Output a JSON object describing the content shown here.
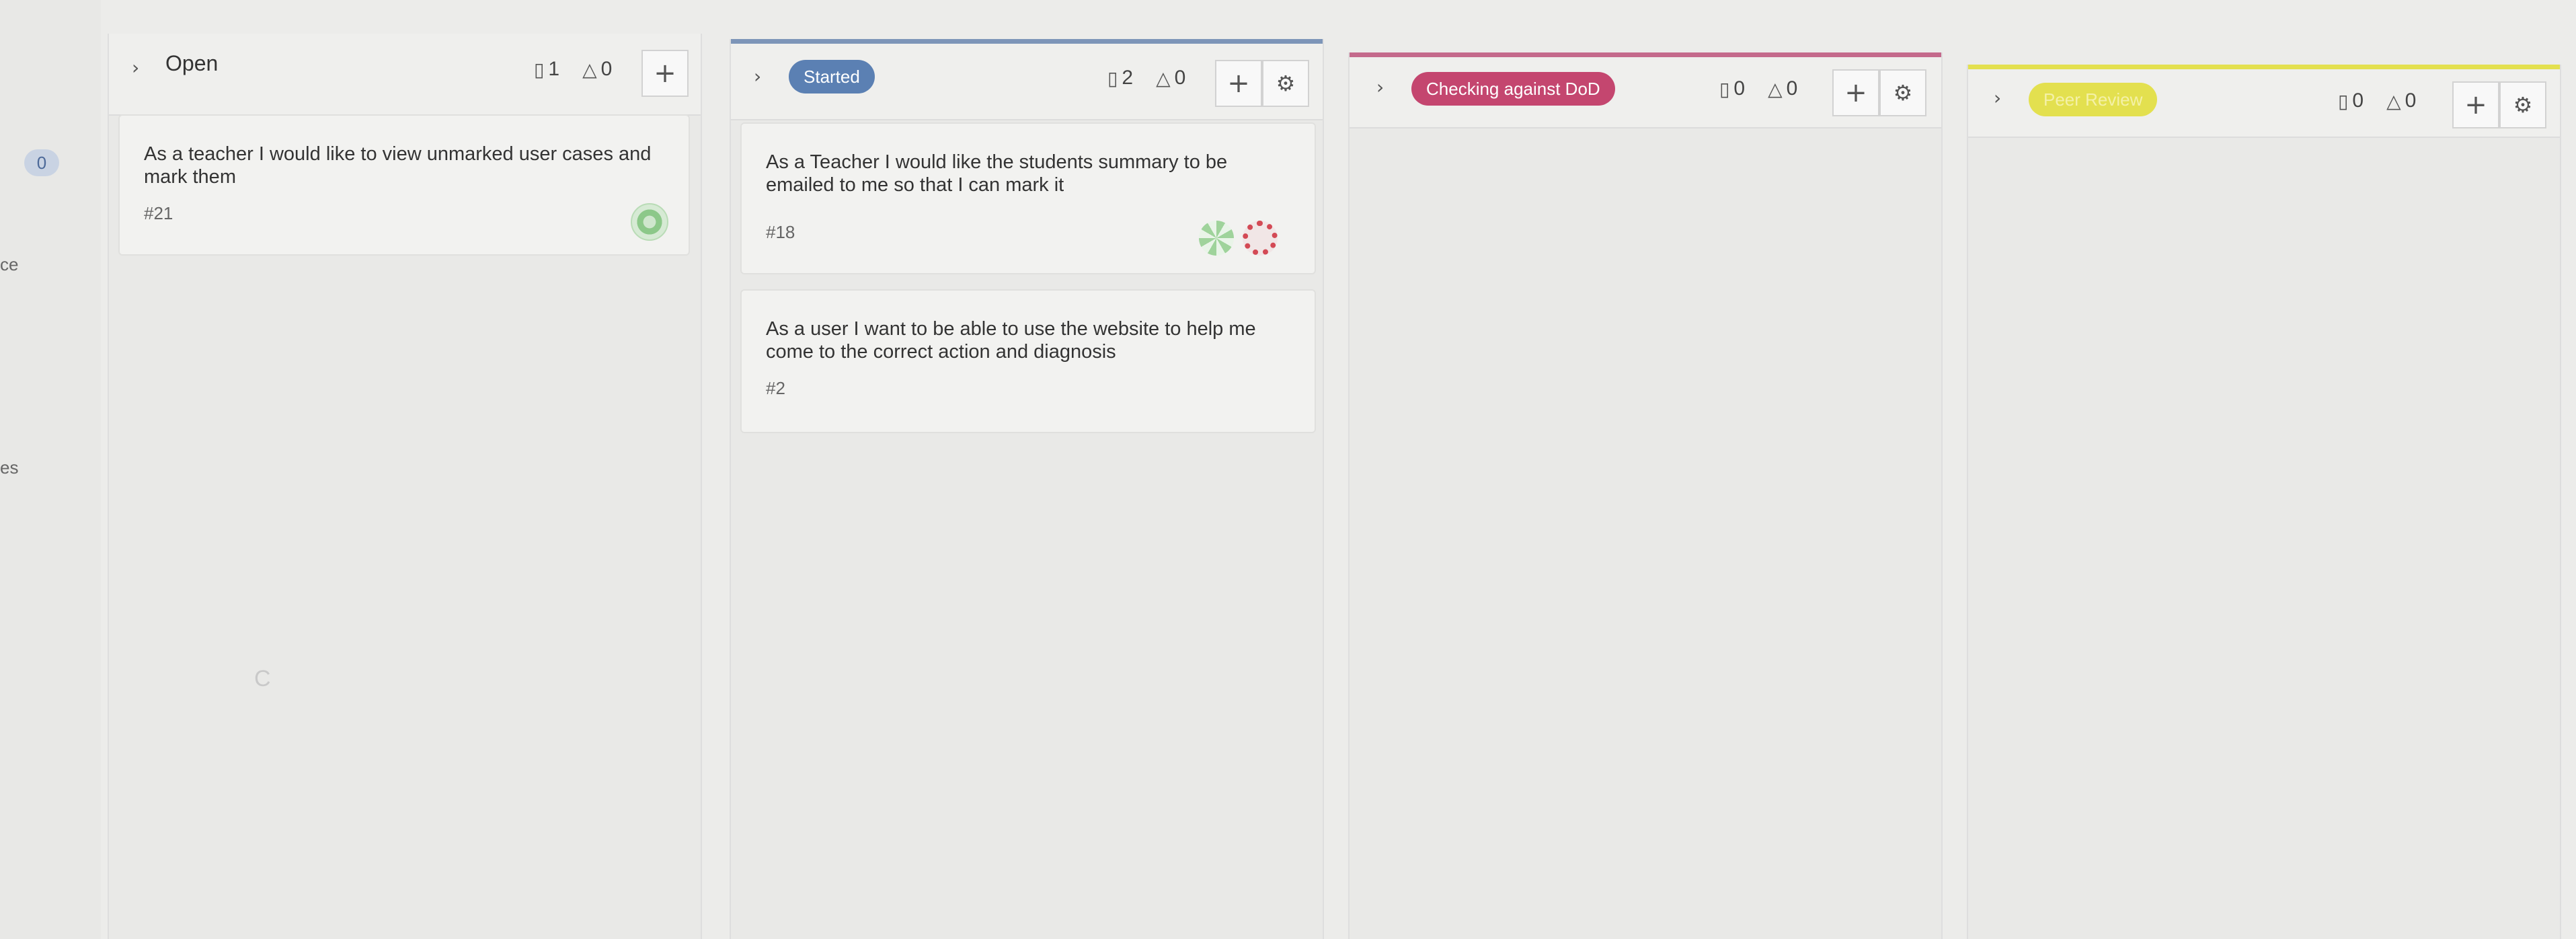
{
  "sidebar": {
    "badge": "0",
    "fragment_1": "ce",
    "fragment_2": "es"
  },
  "columns": [
    {
      "title": "Open",
      "story_count": "1",
      "task_count": "0",
      "add_label": "+",
      "cards": [
        {
          "title": "As a teacher I would like to view unmarked user cases and mark them",
          "number": "#21"
        }
      ]
    },
    {
      "title": "Started",
      "color": "#5b80b3",
      "story_count": "2",
      "task_count": "0",
      "add_label": "+",
      "cards": [
        {
          "title": "As a Teacher I would like the students summary to be emailed to me so that I can mark it",
          "number": "#18"
        },
        {
          "title": "As a user I want to be able to use the website to help me come to the correct action and diagnosis",
          "number": "#2"
        }
      ]
    },
    {
      "title": "Checking against DoD",
      "color": "#c4466f",
      "story_count": "0",
      "task_count": "0",
      "add_label": "+",
      "cards": []
    },
    {
      "title": "Peer Review",
      "color": "#e3e04f",
      "story_count": "0",
      "task_count": "0",
      "add_label": "+",
      "cards": []
    }
  ],
  "icons": {
    "chevron": "chevron-right-icon",
    "story": "story-card-icon",
    "task": "task-bell-icon",
    "add": "plus-icon",
    "settings": "gear-icon"
  },
  "faint_mark": "C"
}
